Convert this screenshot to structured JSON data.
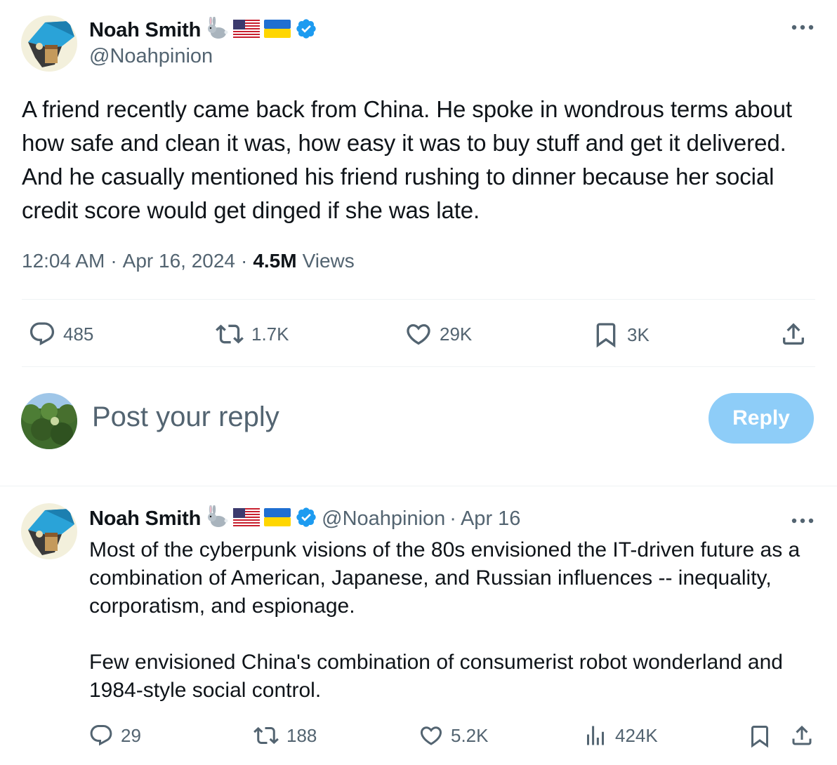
{
  "main_tweet": {
    "author_name": "Noah Smith",
    "author_handle": "@Noahpinion",
    "more_icon": "more-dots-icon",
    "text": "A friend recently came back from China. He spoke in wondrous terms about how safe and clean it was, how easy it was to buy stuff and get it delivered. And he casually mentioned his friend rushing to dinner because her social credit score would get dinged if she was late.",
    "time": "12:04 AM",
    "separator": "·",
    "date": "Apr 16, 2024",
    "views_count": "4.5M",
    "views_label": "Views",
    "actions": {
      "replies": "485",
      "reposts": "1.7K",
      "likes": "29K",
      "bookmarks": "3K"
    }
  },
  "composer": {
    "placeholder": "Post your reply",
    "button_label": "Reply"
  },
  "reply_tweet": {
    "author_name": "Noah Smith",
    "author_handle": "@Noahpinion",
    "separator": "·",
    "date": "Apr 16",
    "paragraph_1": "Most of the cyberpunk visions of the 80s envisioned the IT-driven future as a combination of American, Japanese, and Russian influences -- inequality, corporatism, and espionage.",
    "paragraph_2": "Few envisioned China's combination of consumerist robot wonderland and 1984-style social control.",
    "actions": {
      "replies": "29",
      "reposts": "188",
      "likes": "5.2K",
      "views": "424K"
    }
  },
  "colors": {
    "verified": "#1d9bf0",
    "text_secondary": "#536471",
    "reply_button_disabled": "#8ecdf8"
  }
}
